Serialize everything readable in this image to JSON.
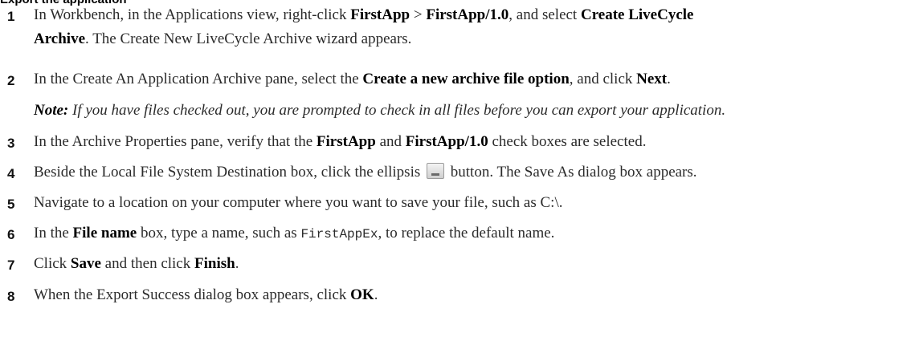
{
  "heading": "Export the application",
  "steps": [
    {
      "num": "1",
      "t1": "In Workbench, in the Applications view, right-click ",
      "b1": "FirstApp",
      "t2": " > ",
      "b2": "FirstApp/1.0",
      "t3": ", and select ",
      "b3": "Create LiveCycle",
      "b3b": "Archive",
      "t4": ". The Create New LiveCycle Archive wizard appears."
    },
    {
      "num": "2",
      "t1": "In the Create An Application Archive pane, select the ",
      "b1": "Create a new archive file option",
      "t2": ", and click ",
      "b2": "Next",
      "t3": ".",
      "note_label": "Note:",
      "note_text": " If you have files checked out, you are prompted to check in all files before you can export your application."
    },
    {
      "num": "3",
      "t1": "In the Archive Properties pane, verify that the ",
      "b1": "FirstApp",
      "t2": " and ",
      "b2": "FirstApp/1.0",
      "t3": " check boxes are selected."
    },
    {
      "num": "4",
      "t1": "Beside the Local File System Destination box, click the ellipsis",
      "t2": "button. The Save As dialog box appears."
    },
    {
      "num": "5",
      "t1": "Navigate to a location on your computer where you want to save your file, such as C:\\."
    },
    {
      "num": "6",
      "t1": "In the ",
      "b1": "File name",
      "t2": " box, type a name, such as ",
      "code": "FirstAppEx",
      "t3": ", to replace the default name."
    },
    {
      "num": "7",
      "t1": "Click ",
      "b1": "Save",
      "t2": " and then click ",
      "b2": "Finish",
      "t3": "."
    },
    {
      "num": "8",
      "t1": "When the Export Success dialog box appears, click ",
      "b1": "OK",
      "t2": "."
    }
  ]
}
